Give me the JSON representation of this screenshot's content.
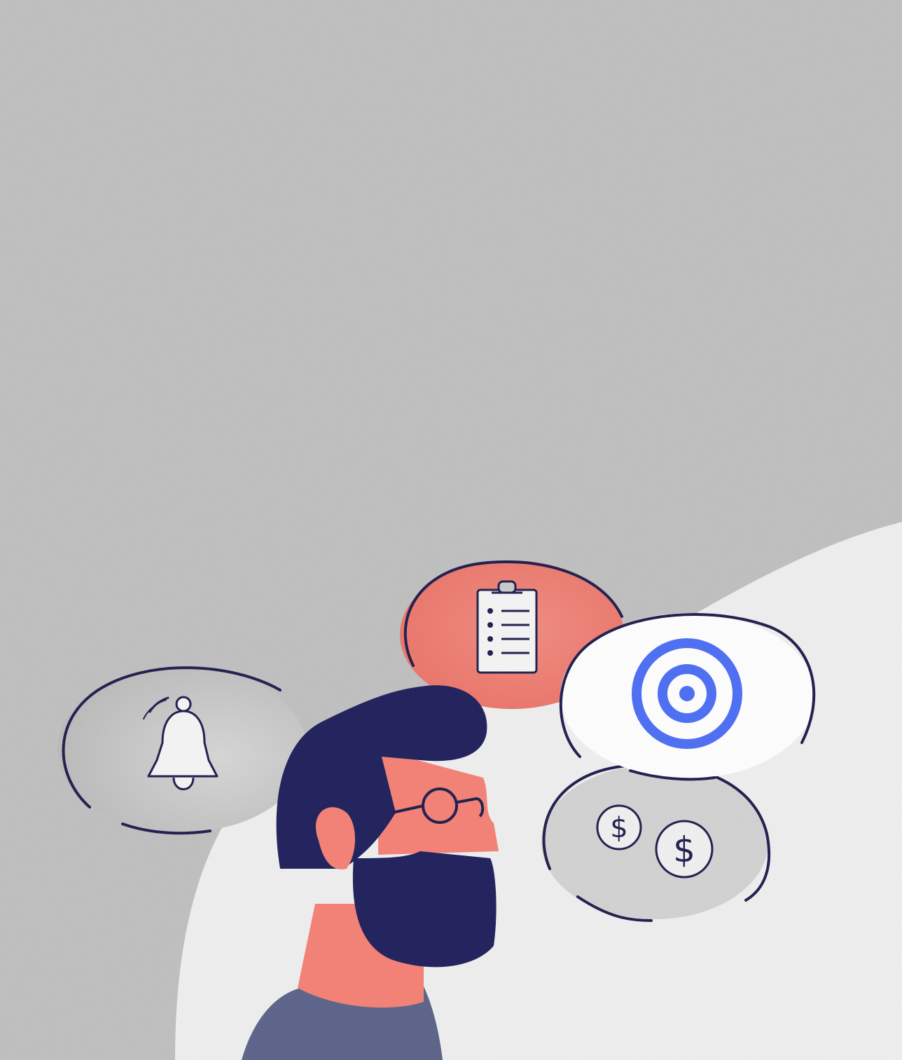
{
  "illustration": {
    "icons": [
      "bell-icon",
      "clipboard-icon",
      "target-icon",
      "dollar-coins-icon"
    ],
    "colors": {
      "background": "#bfbfbf",
      "wave": "#efefef",
      "bubble_gray": "#c9c9c9",
      "bubble_coral": "#f17d72",
      "bubble_white": "#ffffff",
      "outline": "#1b1b4b",
      "hair_beard": "#1c1c5a",
      "skin": "#f57f73",
      "shirt": "#5a6188",
      "target_blue": "#4a6cf5"
    }
  }
}
